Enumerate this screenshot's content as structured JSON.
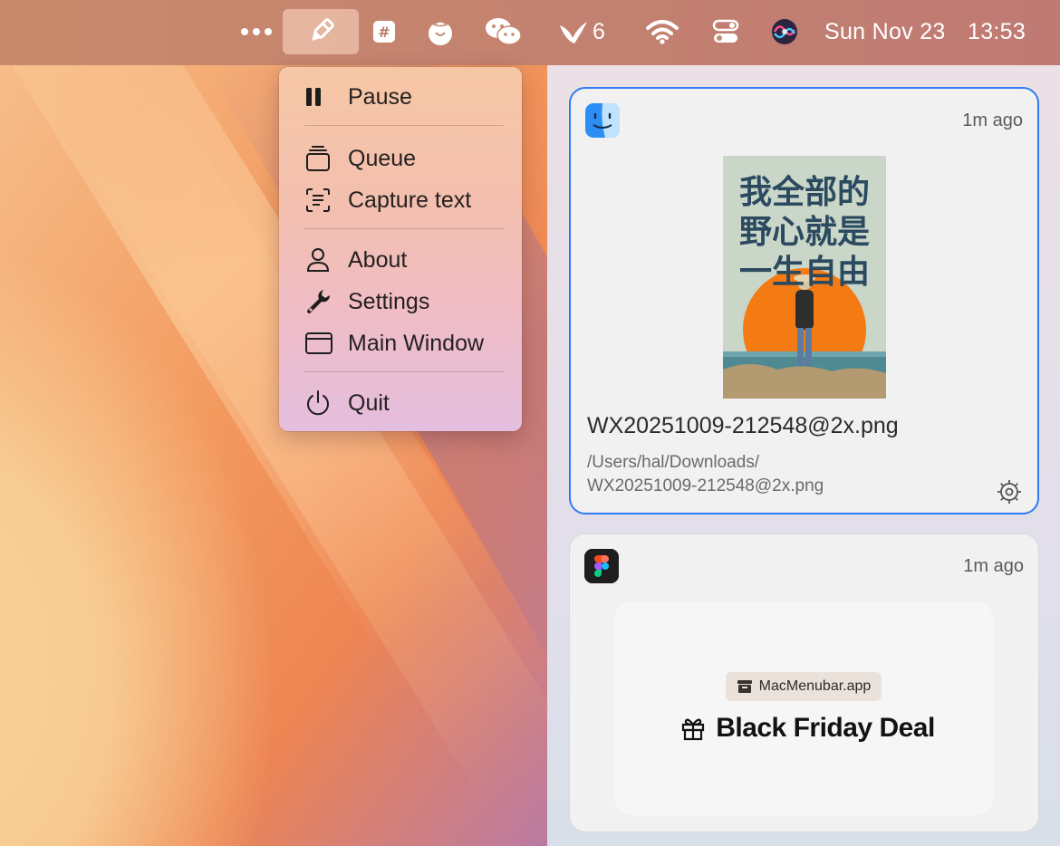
{
  "menubar": {
    "more_icon": "ellipsis-icon",
    "app_icon": "pen-marker-icon",
    "hash_icon": "hash-icon",
    "tomato_icon": "tomato-icon",
    "wechat_icon": "wechat-icon",
    "bird_badge": "6",
    "wifi_icon": "wifi-icon",
    "control_center_icon": "control-center-icon",
    "siri_icon": "siri-icon",
    "date": "Sun Nov 23",
    "time": "13:53"
  },
  "menu": {
    "items": [
      {
        "label": "Pause",
        "icon": "pause-icon"
      },
      {
        "label": "Queue",
        "icon": "stack-icon"
      },
      {
        "label": "Capture text",
        "icon": "text-scan-icon"
      },
      {
        "label": "About",
        "icon": "person-icon"
      },
      {
        "label": "Settings",
        "icon": "wrench-icon"
      },
      {
        "label": "Main Window",
        "icon": "window-icon"
      },
      {
        "label": "Quit",
        "icon": "power-icon"
      }
    ]
  },
  "notifications": [
    {
      "app_icon": "finder-icon",
      "time": "1m ago",
      "filename": "WX20251009-212548@2x.png",
      "path_line1": "/Users/hal/Downloads/",
      "path_line2": "WX20251009-212548@2x.png",
      "poster_text": [
        "我全部的",
        "野心就是",
        "一生自由"
      ]
    },
    {
      "app_icon": "figma-icon",
      "time": "1m ago",
      "tag": "MacMenubar.app",
      "title": "Black Friday Deal"
    }
  ]
}
